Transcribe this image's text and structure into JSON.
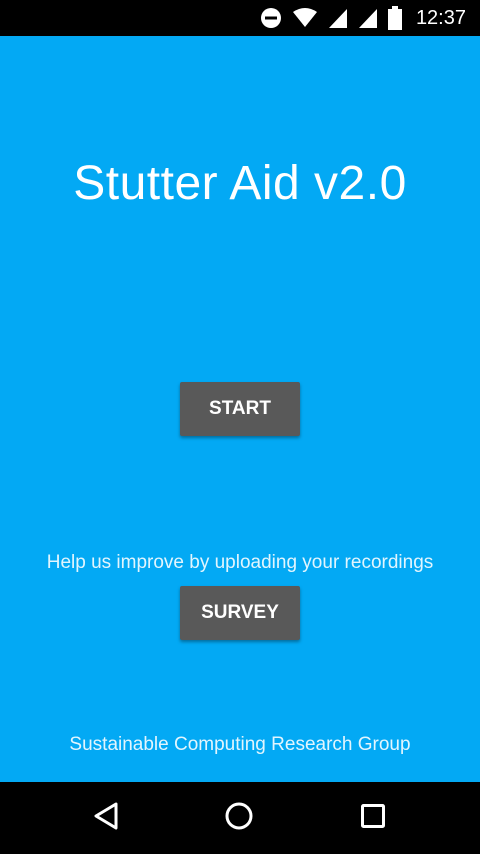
{
  "status_bar": {
    "time": "12:37",
    "icons": [
      "do-not-disturb-icon",
      "wifi-icon",
      "signal-icon",
      "signal-icon",
      "battery-icon"
    ]
  },
  "app": {
    "title": "Stutter Aid v2.0",
    "start_label": "START",
    "help_text": "Help us improve by uploading your recordings",
    "survey_label": "SURVEY",
    "footer": "Sustainable Computing Research Group"
  },
  "nav_bar": {
    "icons": [
      "back-icon",
      "home-icon",
      "recents-icon"
    ]
  },
  "colors": {
    "background": "#03A9F4",
    "button": "#595959",
    "bars": "#000000",
    "text": "#FFFFFF"
  }
}
